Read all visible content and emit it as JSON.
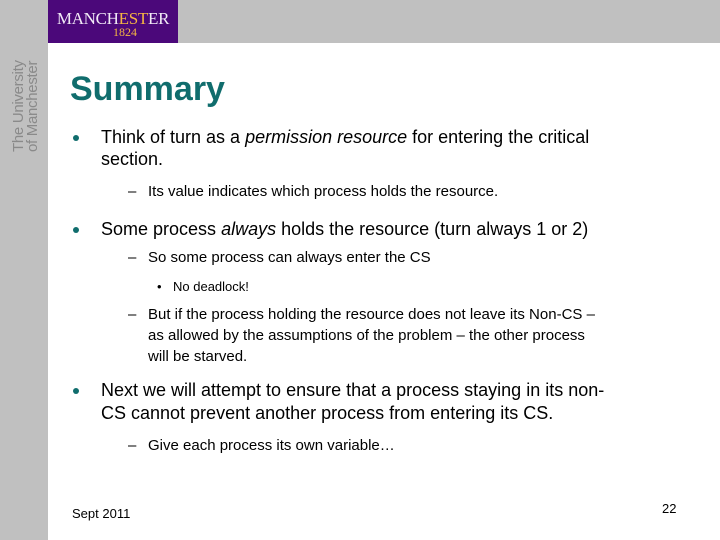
{
  "branding": {
    "logo_name_part1": "MANCH",
    "logo_name_highlight": "EST",
    "logo_name_part2": "ER",
    "logo_year": "1824",
    "wordmark_line1": "The University",
    "wordmark_line2": "of Manchester",
    "colors": {
      "purple": "#4b087a",
      "gold": "#f5b642",
      "teal": "#106d6d",
      "grey": "#c0c0c0"
    }
  },
  "slide": {
    "title": "Summary",
    "bullets": [
      {
        "line1_pre": "Think of turn as a ",
        "line1_em": "permission resource",
        "line1_post": " for entering the critical",
        "line2": "section.",
        "subs": [
          {
            "text": "Its value indicates which process holds the resource."
          }
        ]
      },
      {
        "line1_pre": "Some process ",
        "line1_em": "always",
        "line1_post": " holds the resource (turn always 1 or 2)",
        "subs": [
          {
            "text": "So some process can always enter the CS",
            "subsubs": [
              "No deadlock!"
            ]
          },
          {
            "lines": [
              "But if the process holding the resource does not leave its Non-CS –",
              "as allowed by the assumptions of the problem – the other process",
              "will be starved."
            ]
          }
        ]
      },
      {
        "line1": "Next we will attempt to ensure that a process staying in its non-",
        "line2": "CS cannot prevent another process from entering its CS.",
        "subs": [
          {
            "text": "Give each process its own variable…"
          }
        ]
      }
    ],
    "dash_glyph": "–",
    "subsub_glyph": "•"
  },
  "footer": {
    "date": "Sept 2011",
    "page_number": "22"
  }
}
